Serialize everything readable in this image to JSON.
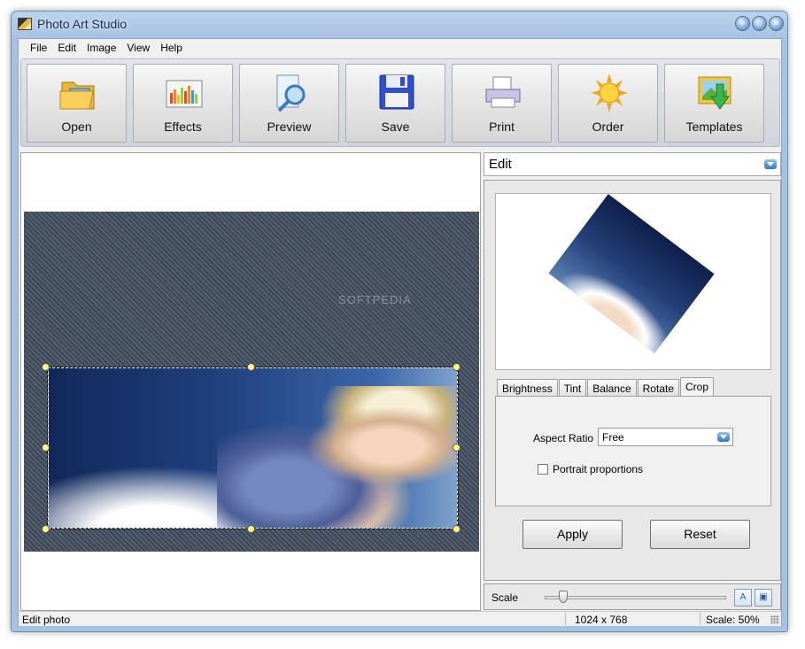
{
  "window": {
    "title": "Photo Art Studio"
  },
  "menu": [
    "File",
    "Edit",
    "Image",
    "View",
    "Help"
  ],
  "toolbar": {
    "buttons": [
      {
        "label": "Open",
        "icon": "folder-icon"
      },
      {
        "label": "Effects",
        "icon": "effects-chart-icon"
      },
      {
        "label": "Preview",
        "icon": "magnifier-icon"
      },
      {
        "label": "Save",
        "icon": "floppy-disk-icon"
      },
      {
        "label": "Print",
        "icon": "printer-icon"
      },
      {
        "label": "Order",
        "icon": "sun-icon"
      },
      {
        "label": "Templates",
        "icon": "template-arrow-icon"
      }
    ]
  },
  "canvas": {
    "watermark": "SOFTPEDIA"
  },
  "panel": {
    "mode": "Edit",
    "tabs": [
      "Brightness",
      "Tint",
      "Balance",
      "Rotate",
      "Crop"
    ],
    "active_tab": "Crop",
    "crop": {
      "aspect_ratio_label": "Aspect Ratio",
      "aspect_ratio_value": "Free",
      "portrait_label": "Portrait proportions",
      "portrait_checked": false
    },
    "apply_label": "Apply",
    "reset_label": "Reset",
    "scale_label": "Scale",
    "scale_level": 0.08
  },
  "status": {
    "message": "Edit photo",
    "dimensions": "1024 x 768",
    "scale": "Scale: 50%"
  },
  "colors": {
    "accent": "#2f78cc",
    "title_bar": "#a7c1e0"
  }
}
